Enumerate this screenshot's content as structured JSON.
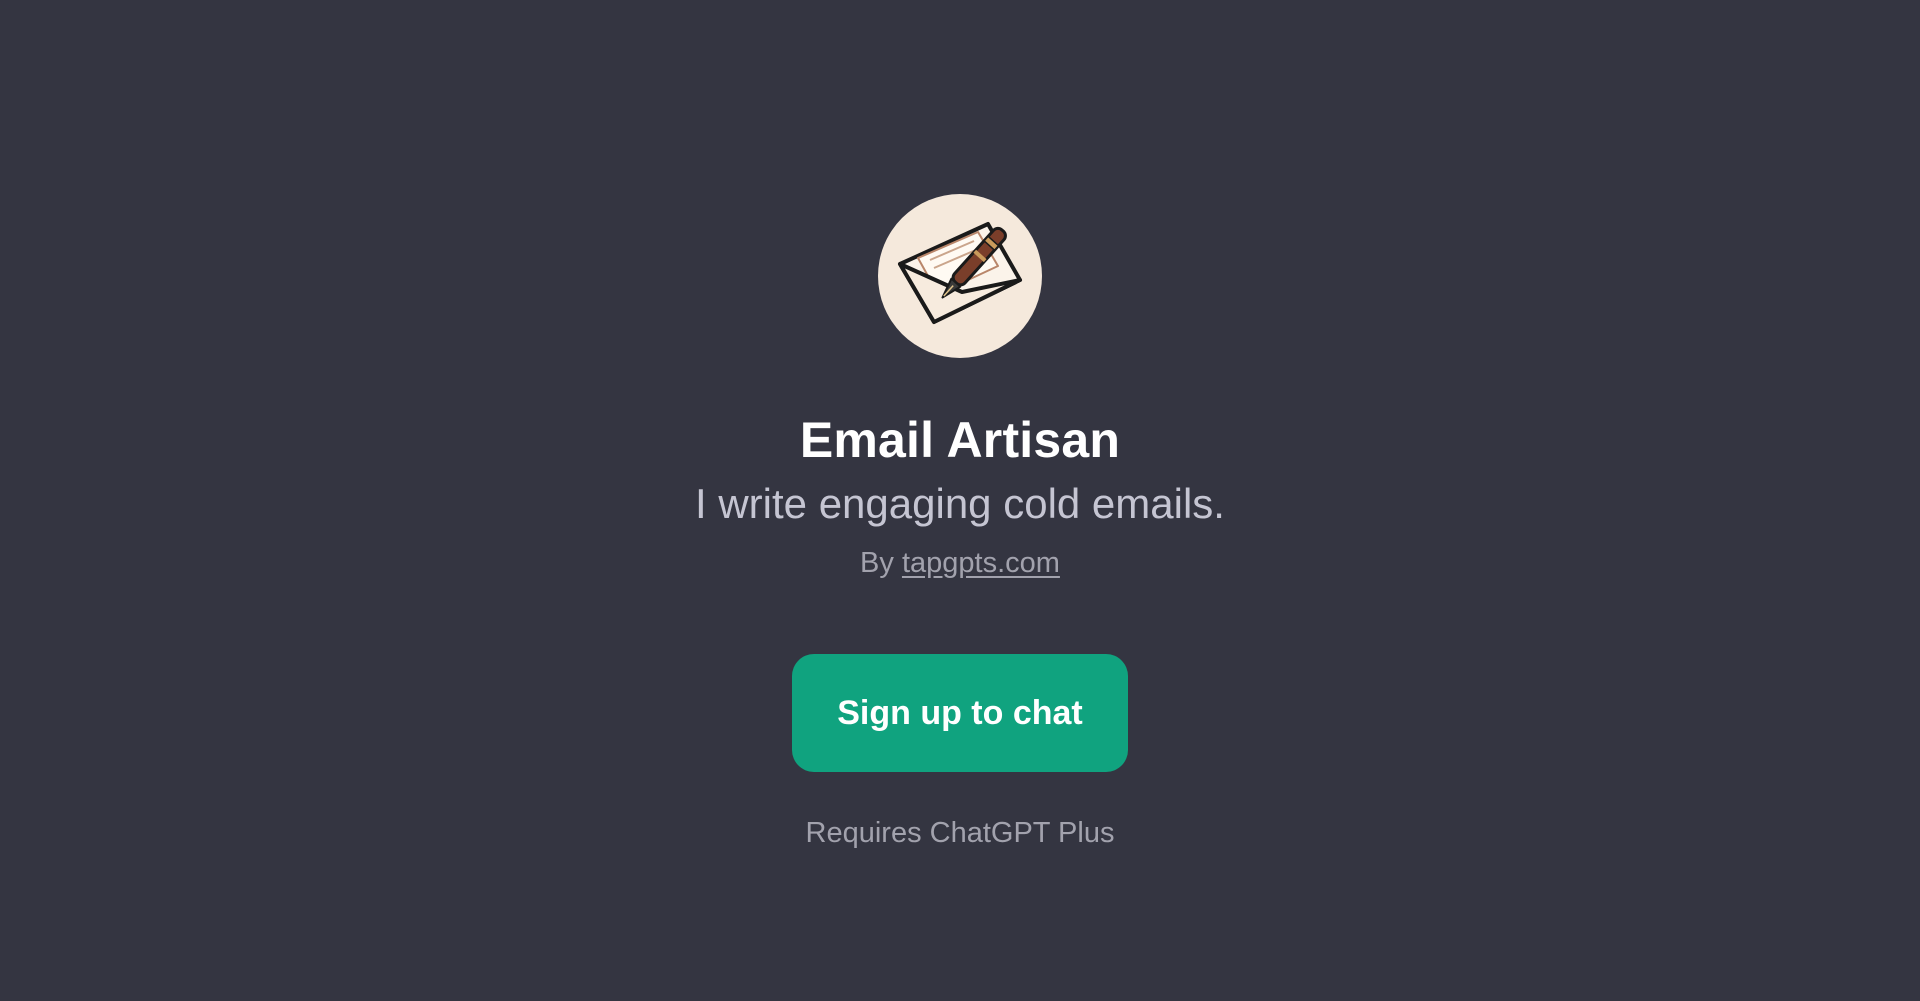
{
  "gpt": {
    "logo_icon": "envelope-with-fountain-pen-icon",
    "name": "Email Artisan",
    "description": "I write engaging cold emails.",
    "by_prefix": "By",
    "author_link": "tapgpts.com"
  },
  "actions": {
    "signup_label": "Sign up to chat",
    "requirement_note": "Requires ChatGPT Plus"
  },
  "colors": {
    "background": "#343541",
    "accent": "#10a37f",
    "avatar_bg": "#f5e9dc"
  }
}
